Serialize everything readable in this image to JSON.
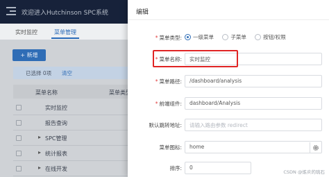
{
  "app": {
    "title": "欢迎进入Hutchinson SPC系统"
  },
  "tabs": [
    {
      "label": "实时监控",
      "active": false
    },
    {
      "label": "菜单管理",
      "active": true
    }
  ],
  "toolbar": {
    "add_label": "+ 新增",
    "selected_text": "已选择 0项",
    "clear_label": "清空"
  },
  "table": {
    "columns": [
      "菜单名称",
      "菜单类型"
    ],
    "rows": [
      {
        "name": "实时监控",
        "expandable": false
      },
      {
        "name": "报告查询",
        "expandable": false
      },
      {
        "name": "SPC管理",
        "expandable": true
      },
      {
        "name": "统计报表",
        "expandable": true
      },
      {
        "name": "在线开发",
        "expandable": true
      }
    ]
  },
  "drawer": {
    "title": "编辑",
    "menu_type": {
      "label": "菜单类型:",
      "options": [
        "一级菜单",
        "子菜单",
        "按钮/权限"
      ],
      "selected": "一级菜单"
    },
    "menu_name": {
      "label": "菜单名称:",
      "value": "实时监控"
    },
    "menu_path": {
      "label": "菜单路径:",
      "value": "/dashboard/analysis"
    },
    "front_component": {
      "label": "前端组件:",
      "value": "dashboard/Analysis"
    },
    "default_redirect": {
      "label": "默认跳转地址:",
      "placeholder": "请输入路由参数 redirect"
    },
    "menu_icon": {
      "label": "菜单图标:",
      "value": "home"
    },
    "sort": {
      "label": "排序:",
      "value": "0"
    }
  },
  "watermark": "CSDN @炼炎的琉石",
  "colors": {
    "primary": "#2f6db6",
    "required": "#e23c3c",
    "highlight_border": "#e02424",
    "topbar": "#17223a"
  }
}
